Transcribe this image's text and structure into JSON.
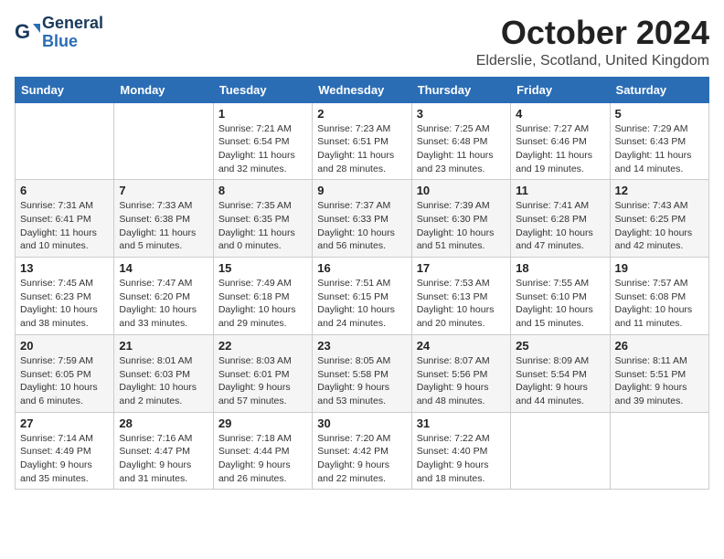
{
  "logo": {
    "line1": "General",
    "line2": "Blue"
  },
  "title": "October 2024",
  "location": "Elderslie, Scotland, United Kingdom",
  "weekdays": [
    "Sunday",
    "Monday",
    "Tuesday",
    "Wednesday",
    "Thursday",
    "Friday",
    "Saturday"
  ],
  "weeks": [
    [
      {
        "day": "",
        "sunrise": "",
        "sunset": "",
        "daylight": ""
      },
      {
        "day": "",
        "sunrise": "",
        "sunset": "",
        "daylight": ""
      },
      {
        "day": "1",
        "sunrise": "Sunrise: 7:21 AM",
        "sunset": "Sunset: 6:54 PM",
        "daylight": "Daylight: 11 hours and 32 minutes."
      },
      {
        "day": "2",
        "sunrise": "Sunrise: 7:23 AM",
        "sunset": "Sunset: 6:51 PM",
        "daylight": "Daylight: 11 hours and 28 minutes."
      },
      {
        "day": "3",
        "sunrise": "Sunrise: 7:25 AM",
        "sunset": "Sunset: 6:48 PM",
        "daylight": "Daylight: 11 hours and 23 minutes."
      },
      {
        "day": "4",
        "sunrise": "Sunrise: 7:27 AM",
        "sunset": "Sunset: 6:46 PM",
        "daylight": "Daylight: 11 hours and 19 minutes."
      },
      {
        "day": "5",
        "sunrise": "Sunrise: 7:29 AM",
        "sunset": "Sunset: 6:43 PM",
        "daylight": "Daylight: 11 hours and 14 minutes."
      }
    ],
    [
      {
        "day": "6",
        "sunrise": "Sunrise: 7:31 AM",
        "sunset": "Sunset: 6:41 PM",
        "daylight": "Daylight: 11 hours and 10 minutes."
      },
      {
        "day": "7",
        "sunrise": "Sunrise: 7:33 AM",
        "sunset": "Sunset: 6:38 PM",
        "daylight": "Daylight: 11 hours and 5 minutes."
      },
      {
        "day": "8",
        "sunrise": "Sunrise: 7:35 AM",
        "sunset": "Sunset: 6:35 PM",
        "daylight": "Daylight: 11 hours and 0 minutes."
      },
      {
        "day": "9",
        "sunrise": "Sunrise: 7:37 AM",
        "sunset": "Sunset: 6:33 PM",
        "daylight": "Daylight: 10 hours and 56 minutes."
      },
      {
        "day": "10",
        "sunrise": "Sunrise: 7:39 AM",
        "sunset": "Sunset: 6:30 PM",
        "daylight": "Daylight: 10 hours and 51 minutes."
      },
      {
        "day": "11",
        "sunrise": "Sunrise: 7:41 AM",
        "sunset": "Sunset: 6:28 PM",
        "daylight": "Daylight: 10 hours and 47 minutes."
      },
      {
        "day": "12",
        "sunrise": "Sunrise: 7:43 AM",
        "sunset": "Sunset: 6:25 PM",
        "daylight": "Daylight: 10 hours and 42 minutes."
      }
    ],
    [
      {
        "day": "13",
        "sunrise": "Sunrise: 7:45 AM",
        "sunset": "Sunset: 6:23 PM",
        "daylight": "Daylight: 10 hours and 38 minutes."
      },
      {
        "day": "14",
        "sunrise": "Sunrise: 7:47 AM",
        "sunset": "Sunset: 6:20 PM",
        "daylight": "Daylight: 10 hours and 33 minutes."
      },
      {
        "day": "15",
        "sunrise": "Sunrise: 7:49 AM",
        "sunset": "Sunset: 6:18 PM",
        "daylight": "Daylight: 10 hours and 29 minutes."
      },
      {
        "day": "16",
        "sunrise": "Sunrise: 7:51 AM",
        "sunset": "Sunset: 6:15 PM",
        "daylight": "Daylight: 10 hours and 24 minutes."
      },
      {
        "day": "17",
        "sunrise": "Sunrise: 7:53 AM",
        "sunset": "Sunset: 6:13 PM",
        "daylight": "Daylight: 10 hours and 20 minutes."
      },
      {
        "day": "18",
        "sunrise": "Sunrise: 7:55 AM",
        "sunset": "Sunset: 6:10 PM",
        "daylight": "Daylight: 10 hours and 15 minutes."
      },
      {
        "day": "19",
        "sunrise": "Sunrise: 7:57 AM",
        "sunset": "Sunset: 6:08 PM",
        "daylight": "Daylight: 10 hours and 11 minutes."
      }
    ],
    [
      {
        "day": "20",
        "sunrise": "Sunrise: 7:59 AM",
        "sunset": "Sunset: 6:05 PM",
        "daylight": "Daylight: 10 hours and 6 minutes."
      },
      {
        "day": "21",
        "sunrise": "Sunrise: 8:01 AM",
        "sunset": "Sunset: 6:03 PM",
        "daylight": "Daylight: 10 hours and 2 minutes."
      },
      {
        "day": "22",
        "sunrise": "Sunrise: 8:03 AM",
        "sunset": "Sunset: 6:01 PM",
        "daylight": "Daylight: 9 hours and 57 minutes."
      },
      {
        "day": "23",
        "sunrise": "Sunrise: 8:05 AM",
        "sunset": "Sunset: 5:58 PM",
        "daylight": "Daylight: 9 hours and 53 minutes."
      },
      {
        "day": "24",
        "sunrise": "Sunrise: 8:07 AM",
        "sunset": "Sunset: 5:56 PM",
        "daylight": "Daylight: 9 hours and 48 minutes."
      },
      {
        "day": "25",
        "sunrise": "Sunrise: 8:09 AM",
        "sunset": "Sunset: 5:54 PM",
        "daylight": "Daylight: 9 hours and 44 minutes."
      },
      {
        "day": "26",
        "sunrise": "Sunrise: 8:11 AM",
        "sunset": "Sunset: 5:51 PM",
        "daylight": "Daylight: 9 hours and 39 minutes."
      }
    ],
    [
      {
        "day": "27",
        "sunrise": "Sunrise: 7:14 AM",
        "sunset": "Sunset: 4:49 PM",
        "daylight": "Daylight: 9 hours and 35 minutes."
      },
      {
        "day": "28",
        "sunrise": "Sunrise: 7:16 AM",
        "sunset": "Sunset: 4:47 PM",
        "daylight": "Daylight: 9 hours and 31 minutes."
      },
      {
        "day": "29",
        "sunrise": "Sunrise: 7:18 AM",
        "sunset": "Sunset: 4:44 PM",
        "daylight": "Daylight: 9 hours and 26 minutes."
      },
      {
        "day": "30",
        "sunrise": "Sunrise: 7:20 AM",
        "sunset": "Sunset: 4:42 PM",
        "daylight": "Daylight: 9 hours and 22 minutes."
      },
      {
        "day": "31",
        "sunrise": "Sunrise: 7:22 AM",
        "sunset": "Sunset: 4:40 PM",
        "daylight": "Daylight: 9 hours and 18 minutes."
      },
      {
        "day": "",
        "sunrise": "",
        "sunset": "",
        "daylight": ""
      },
      {
        "day": "",
        "sunrise": "",
        "sunset": "",
        "daylight": ""
      }
    ]
  ]
}
